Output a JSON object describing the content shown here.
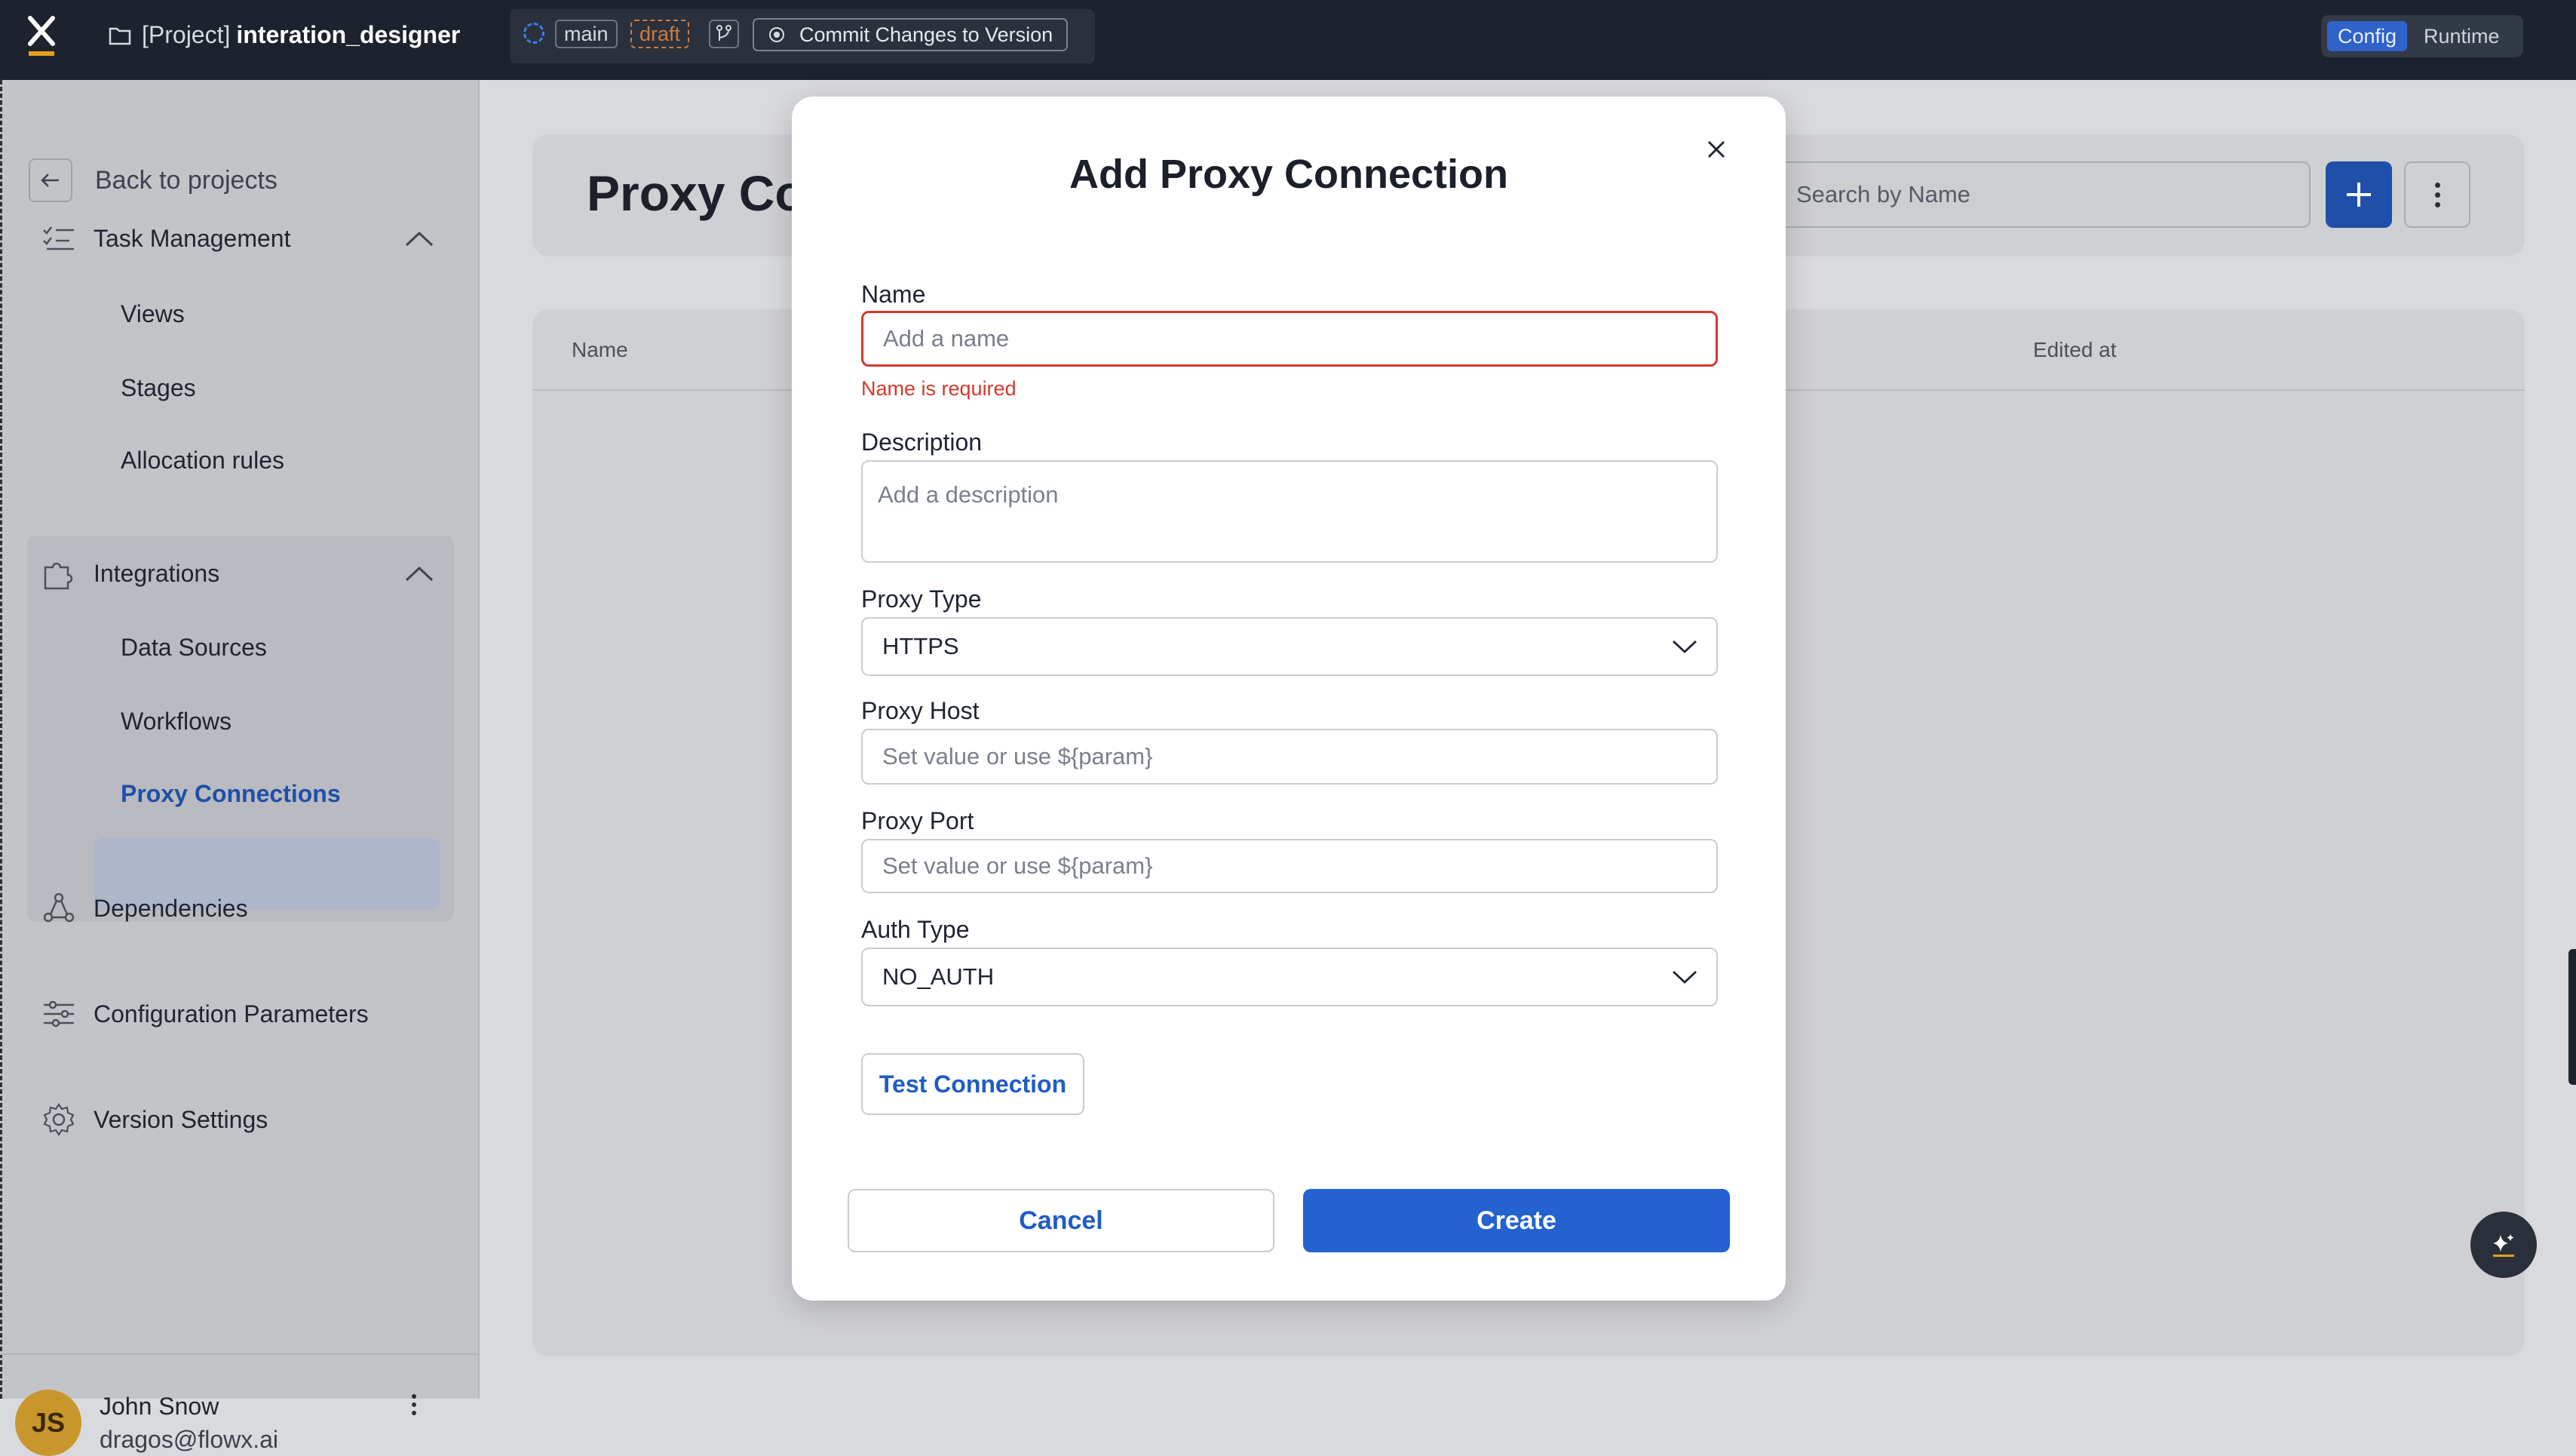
{
  "topbar": {
    "project_prefix": "[Project]",
    "project_name": "interation_designer",
    "branch": "main",
    "status": "draft",
    "commit_label": "Commit Changes to Version",
    "modes": {
      "config": "Config",
      "runtime": "Runtime",
      "active": "Config"
    }
  },
  "sidebar": {
    "back_label": "Back to projects",
    "task_management": {
      "label": "Task Management",
      "items": [
        "Views",
        "Stages",
        "Allocation rules"
      ]
    },
    "integrations": {
      "label": "Integrations",
      "items": [
        "Data Sources",
        "Workflows",
        "Proxy Connections"
      ],
      "active": "Proxy Connections"
    },
    "dependencies": "Dependencies",
    "configuration_parameters": "Configuration Parameters",
    "version_settings": "Version Settings",
    "user": {
      "initials": "JS",
      "name": "John Snow",
      "email": "dragos@flowx.ai"
    }
  },
  "main": {
    "title": "Proxy Co",
    "search_placeholder": "Search by Name",
    "columns": {
      "name": "Name",
      "edited_at": "Edited at"
    }
  },
  "modal": {
    "title": "Add Proxy Connection",
    "name": {
      "label": "Name",
      "placeholder": "Add a name",
      "error": "Name is required"
    },
    "description": {
      "label": "Description",
      "placeholder": "Add a description"
    },
    "proxy_type": {
      "label": "Proxy Type",
      "value": "HTTPS"
    },
    "proxy_host": {
      "label": "Proxy Host",
      "placeholder": "Set value or use ${param}"
    },
    "proxy_port": {
      "label": "Proxy Port",
      "placeholder": "Set value or use ${param}"
    },
    "auth_type": {
      "label": "Auth Type",
      "value": "NO_AUTH"
    },
    "test_connection": "Test Connection",
    "cancel": "Cancel",
    "create": "Create"
  },
  "colors": {
    "accent": "#2362cf",
    "error": "#d33a2c",
    "topbar": "#1d232e",
    "draft": "#d07b3f",
    "avatar": "#c9962e"
  }
}
